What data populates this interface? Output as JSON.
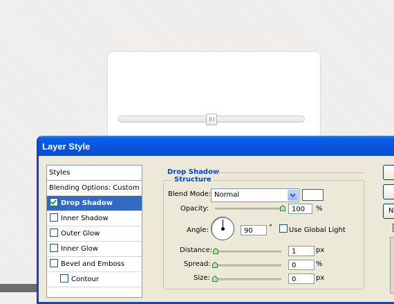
{
  "dialog": {
    "title": "Layer Style"
  },
  "styles_list": {
    "header": "Styles",
    "items": [
      {
        "label": "Blending Options: Custom",
        "checkbox": false,
        "checked": false,
        "selected": false,
        "indent": false
      },
      {
        "label": "Drop Shadow",
        "checkbox": true,
        "checked": true,
        "selected": true,
        "indent": false
      },
      {
        "label": "Inner Shadow",
        "checkbox": true,
        "checked": false,
        "selected": false,
        "indent": false
      },
      {
        "label": "Outer Glow",
        "checkbox": true,
        "checked": false,
        "selected": false,
        "indent": false
      },
      {
        "label": "Inner Glow",
        "checkbox": true,
        "checked": false,
        "selected": false,
        "indent": false
      },
      {
        "label": "Bevel and Emboss",
        "checkbox": true,
        "checked": false,
        "selected": false,
        "indent": false
      },
      {
        "label": "Contour",
        "checkbox": true,
        "checked": false,
        "selected": false,
        "indent": true
      }
    ]
  },
  "panel": {
    "section_title": "Drop Shadow",
    "group_title": "Structure",
    "blend_mode": {
      "label": "Blend Mode:",
      "value": "Normal",
      "color": "#ffffff"
    },
    "opacity": {
      "label": "Opacity:",
      "value": "100",
      "unit": "%",
      "level": 1.0
    },
    "angle": {
      "label": "Angle:",
      "value": "90",
      "unit": "°",
      "degrees": 90
    },
    "global_light": {
      "label": "Use Global Light",
      "checked": false
    },
    "distance": {
      "label": "Distance:",
      "value": "1",
      "unit": "px",
      "level": 0.01
    },
    "spread": {
      "label": "Spread:",
      "value": "0",
      "unit": "%",
      "level": 0.0
    },
    "size": {
      "label": "Size:",
      "value": "0",
      "unit": "px",
      "level": 0.0
    }
  },
  "right_buttons": [
    {
      "label": ""
    },
    {
      "label": ""
    },
    {
      "label": "N"
    }
  ],
  "right_checkbox": {
    "checked": true
  },
  "background_card": {
    "slider_level": 0.5
  },
  "colors": {
    "title_bar": "#0753db",
    "selection": "#316ac5",
    "section_title": "#0046d5"
  }
}
